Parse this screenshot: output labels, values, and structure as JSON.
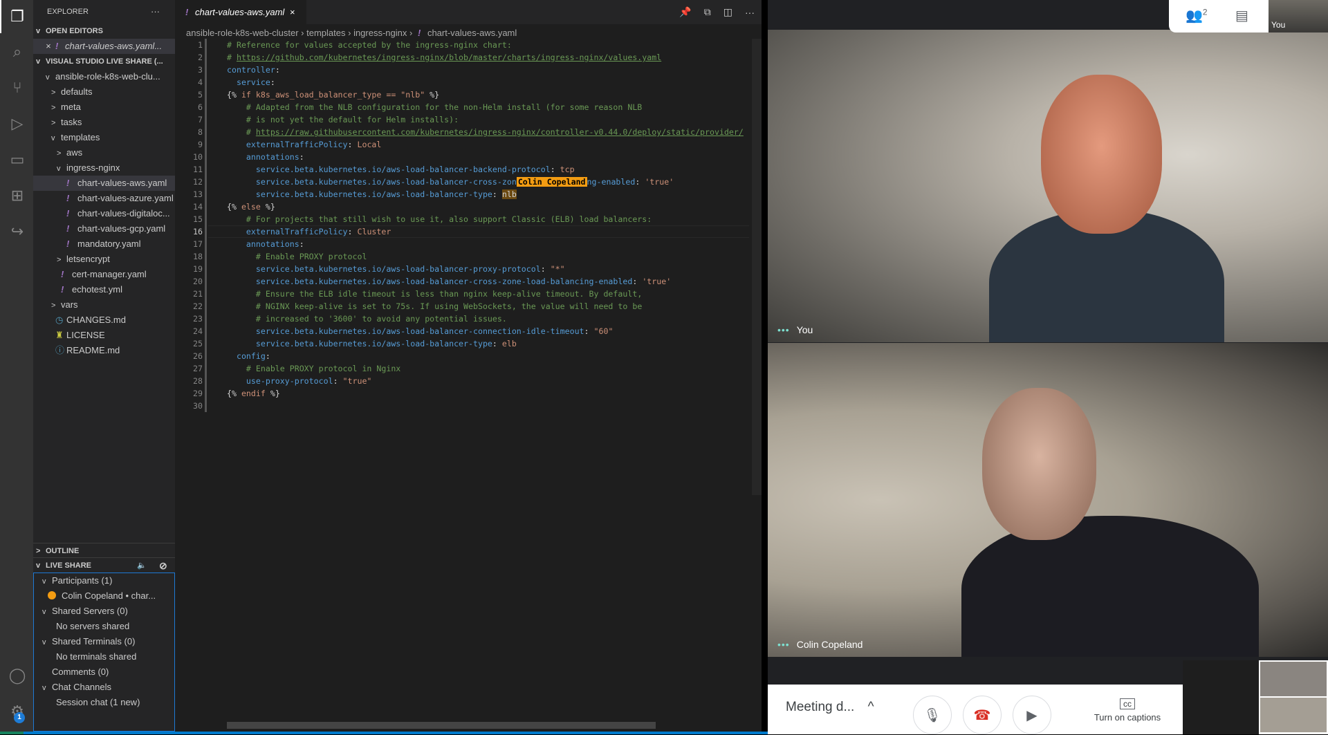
{
  "sidebar": {
    "title": "EXPLORER",
    "more": "···",
    "open_editors": "OPEN EDITORS",
    "open_file": "chart-values-aws.yaml...",
    "workspace": "VISUAL STUDIO LIVE SHARE (...",
    "tree": [
      {
        "label": "ansible-role-k8s-web-clu...",
        "chev": "v",
        "indent": 1
      },
      {
        "label": "defaults",
        "chev": ">",
        "indent": 2
      },
      {
        "label": "meta",
        "chev": ">",
        "indent": 2
      },
      {
        "label": "tasks",
        "chev": ">",
        "indent": 2
      },
      {
        "label": "templates",
        "chev": "v",
        "indent": 2
      },
      {
        "label": "aws",
        "chev": ">",
        "indent": 3
      },
      {
        "label": "ingress-nginx",
        "chev": "v",
        "indent": 3
      },
      {
        "label": "chart-values-aws.yaml",
        "file": "yaml",
        "indent": 4,
        "selected": true
      },
      {
        "label": "chart-values-azure.yaml",
        "file": "yaml",
        "indent": 4
      },
      {
        "label": "chart-values-digitaloc...",
        "file": "yaml",
        "indent": 4
      },
      {
        "label": "chart-values-gcp.yaml",
        "file": "yaml",
        "indent": 4
      },
      {
        "label": "mandatory.yaml",
        "file": "yaml",
        "indent": 4
      },
      {
        "label": "letsencrypt",
        "chev": ">",
        "indent": 3
      },
      {
        "label": "cert-manager.yaml",
        "file": "yaml",
        "indent": 3
      },
      {
        "label": "echotest.yml",
        "file": "yaml",
        "indent": 3
      },
      {
        "label": "vars",
        "chev": ">",
        "indent": 2
      },
      {
        "label": "CHANGES.md",
        "file": "clock",
        "indent": 2
      },
      {
        "label": "LICENSE",
        "file": "license",
        "indent": 2
      },
      {
        "label": "README.md",
        "file": "info",
        "indent": 2
      }
    ],
    "outline": "OUTLINE",
    "live_share": "LIVE SHARE",
    "live_items": [
      {
        "label": "Participants (1)",
        "chev": "v",
        "indent": 1
      },
      {
        "label": "Colin Copeland  •  char...",
        "dot": true,
        "indent": 2
      },
      {
        "label": "Shared Servers (0)",
        "chev": "v",
        "indent": 1
      },
      {
        "label": "No servers shared",
        "indent": 2
      },
      {
        "label": "Shared Terminals (0)",
        "chev": "v",
        "indent": 1
      },
      {
        "label": "No terminals shared",
        "indent": 2
      },
      {
        "label": "Comments (0)",
        "indent": 1
      },
      {
        "label": "Chat Channels",
        "chev": "v",
        "indent": 1
      },
      {
        "label": "Session chat (1 new)",
        "indent": 2
      }
    ],
    "settings_badge": "1"
  },
  "editor": {
    "tab": "chart-values-aws.yaml",
    "breadcrumb": [
      "ansible-role-k8s-web-cluster",
      "templates",
      "ingress-nginx",
      "chart-values-aws.yaml"
    ],
    "current_line": 16,
    "cursor_user": "Colin Copeland",
    "lines": [
      [
        [
          "c",
          "# Reference for values accepted by the ingress-nginx chart:"
        ]
      ],
      [
        [
          "c",
          "# "
        ],
        [
          "u",
          "https://github.com/kubernetes/ingress-nginx/blob/master/charts/ingress-nginx/values.yaml"
        ]
      ],
      [
        [
          "k",
          "controller"
        ],
        [
          "j",
          ":"
        ]
      ],
      [
        [
          "j",
          "  "
        ],
        [
          "k",
          "service"
        ],
        [
          "j",
          ":"
        ]
      ],
      [
        [
          "j",
          "{% "
        ],
        [
          "w",
          "if k8s_aws_load_balancer_type == \"nlb\""
        ],
        [
          "j",
          " %}"
        ]
      ],
      [
        [
          "j",
          "    "
        ],
        [
          "c",
          "# Adapted from the NLB configuration for the non-Helm install (for some reason NLB"
        ]
      ],
      [
        [
          "j",
          "    "
        ],
        [
          "c",
          "# is not yet the default for Helm installs):"
        ]
      ],
      [
        [
          "j",
          "    "
        ],
        [
          "c",
          "# "
        ],
        [
          "u",
          "https://raw.githubusercontent.com/kubernetes/ingress-nginx/controller-v0.44.0/deploy/static/provider/"
        ]
      ],
      [
        [
          "j",
          "    "
        ],
        [
          "k",
          "externalTrafficPolicy"
        ],
        [
          "j",
          ": "
        ],
        [
          "s",
          "Local"
        ]
      ],
      [
        [
          "j",
          "    "
        ],
        [
          "k",
          "annotations"
        ],
        [
          "j",
          ":"
        ]
      ],
      [
        [
          "j",
          "      "
        ],
        [
          "k",
          "service.beta.kubernetes.io/aws-load-balancer-backend-protocol"
        ],
        [
          "j",
          ": "
        ],
        [
          "s",
          "tcp"
        ]
      ],
      [
        [
          "j",
          "      "
        ],
        [
          "k",
          "service.beta.kubernetes.io/aws-load-balancer-cross-zon"
        ],
        [
          "flag",
          "Colin Copeland"
        ],
        [
          "k",
          "ng-enabled"
        ],
        [
          "j",
          ": "
        ],
        [
          "s",
          "'true'"
        ]
      ],
      [
        [
          "j",
          "      "
        ],
        [
          "k",
          "service.beta.kubernetes.io/aws-load-balancer-type"
        ],
        [
          "j",
          ": "
        ],
        [
          "hl",
          "nlb"
        ]
      ],
      [
        [
          "j",
          "{% "
        ],
        [
          "w",
          "else"
        ],
        [
          "j",
          " %}"
        ]
      ],
      [
        [
          "j",
          "    "
        ],
        [
          "c",
          "# For projects that still wish to use it, also support Classic (ELB) load balancers:"
        ]
      ],
      [
        [
          "j",
          "    "
        ],
        [
          "k",
          "externalTrafficPolicy"
        ],
        [
          "j",
          ": "
        ],
        [
          "s",
          "Cluster"
        ]
      ],
      [
        [
          "j",
          "    "
        ],
        [
          "k",
          "annotations"
        ],
        [
          "j",
          ":"
        ]
      ],
      [
        [
          "j",
          "      "
        ],
        [
          "c",
          "# Enable PROXY protocol"
        ]
      ],
      [
        [
          "j",
          "      "
        ],
        [
          "k",
          "service.beta.kubernetes.io/aws-load-balancer-proxy-protocol"
        ],
        [
          "j",
          ": "
        ],
        [
          "s",
          "\"*\""
        ]
      ],
      [
        [
          "j",
          "      "
        ],
        [
          "k",
          "service.beta.kubernetes.io/aws-load-balancer-cross-zone-load-balancing-enabled"
        ],
        [
          "j",
          ": "
        ],
        [
          "s",
          "'true'"
        ]
      ],
      [
        [
          "j",
          "      "
        ],
        [
          "c",
          "# Ensure the ELB idle timeout is less than nginx keep-alive timeout. By default,"
        ]
      ],
      [
        [
          "j",
          "      "
        ],
        [
          "c",
          "# NGINX keep-alive is set to 75s. If using WebSockets, the value will need to be"
        ]
      ],
      [
        [
          "j",
          "      "
        ],
        [
          "c",
          "# increased to '3600' to avoid any potential issues."
        ]
      ],
      [
        [
          "j",
          "      "
        ],
        [
          "k",
          "service.beta.kubernetes.io/aws-load-balancer-connection-idle-timeout"
        ],
        [
          "j",
          ": "
        ],
        [
          "s",
          "\"60\""
        ]
      ],
      [
        [
          "j",
          "      "
        ],
        [
          "k",
          "service.beta.kubernetes.io/aws-load-balancer-type"
        ],
        [
          "j",
          ": "
        ],
        [
          "s",
          "elb"
        ]
      ],
      [
        [
          "j",
          "  "
        ],
        [
          "k",
          "config"
        ],
        [
          "j",
          ":"
        ]
      ],
      [
        [
          "j",
          "    "
        ],
        [
          "c",
          "# Enable PROXY protocol in Nginx"
        ]
      ],
      [
        [
          "j",
          "    "
        ],
        [
          "k",
          "use-proxy-protocol"
        ],
        [
          "j",
          ": "
        ],
        [
          "s",
          "\"true\""
        ]
      ],
      [
        [
          "j",
          "{% "
        ],
        [
          "w",
          "endif"
        ],
        [
          "j",
          " %}"
        ]
      ],
      []
    ]
  },
  "meet": {
    "participants_count": "2",
    "self_label": "You",
    "videos": [
      {
        "name": "You"
      },
      {
        "name": "Colin Copeland"
      }
    ],
    "meeting_title": "Meeting d...",
    "captions": "Turn on captions"
  }
}
